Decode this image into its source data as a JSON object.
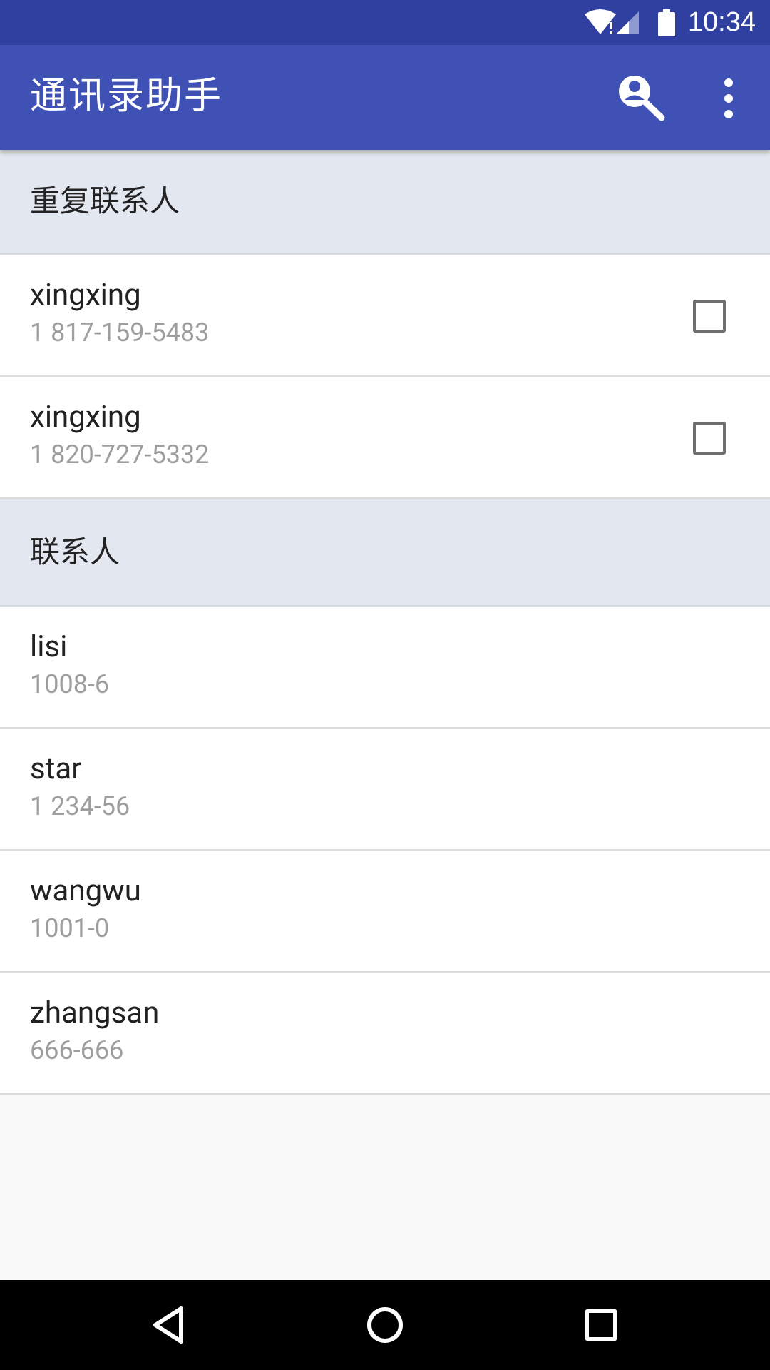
{
  "status_bar": {
    "time": "10:34"
  },
  "app_bar": {
    "title": "通讯录助手",
    "icons": [
      "search-icon",
      "more-vert-icon"
    ]
  },
  "sections": [
    {
      "header": "重复联系人",
      "items": [
        {
          "name": "xingxing",
          "phone": "1 817-159-5483",
          "checked": false
        },
        {
          "name": "xingxing",
          "phone": "1 820-727-5332",
          "checked": false
        }
      ]
    },
    {
      "header": "联系人",
      "items": [
        {
          "name": "lisi",
          "phone": "1008-6"
        },
        {
          "name": "star",
          "phone": "1 234-56"
        },
        {
          "name": "wangwu",
          "phone": "1001-0"
        },
        {
          "name": "zhangsan",
          "phone": "666-666"
        }
      ]
    }
  ],
  "nav_bar": {
    "icons": [
      "back-icon",
      "home-icon",
      "recents-icon"
    ]
  },
  "colors": {
    "status_bar": "#3040a0",
    "app_bar": "#3f51b5",
    "section_header": "#e3e7f0",
    "secondary_text": "#9e9e9e"
  }
}
